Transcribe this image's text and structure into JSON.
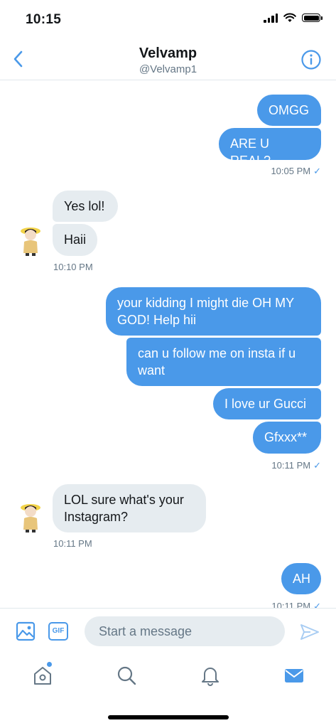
{
  "status_bar": {
    "time": "10:15"
  },
  "header": {
    "name": "Velvamp",
    "handle": "@Velvamp1"
  },
  "messages": [
    {
      "text": "OMGG"
    },
    {
      "text": "ARE U REAL?"
    },
    {
      "time": "10:05 PM",
      "check": "✓"
    },
    {
      "text": "Yes lol!"
    },
    {
      "text": "Haii"
    },
    {
      "time": "10:10 PM"
    },
    {
      "text": "your kidding I might die OH MY GOD! Help hii"
    },
    {
      "text": "can u follow me on insta if u want"
    },
    {
      "text": "I love ur Gucci"
    },
    {
      "text": "Gfxxx**"
    },
    {
      "time": "10:11 PM",
      "check": "✓"
    },
    {
      "text": "LOL sure what's your Instagram?"
    },
    {
      "time": "10:11 PM"
    },
    {
      "text": "AH"
    },
    {
      "time": "10:11 PM",
      "check": "✓"
    }
  ],
  "composer": {
    "placeholder": "Start a message",
    "gif_label": "GIF"
  },
  "tabbar": {
    "home_has_notification": true
  },
  "colors": {
    "accent": "#4a99e9",
    "incoming_bubble": "#e6ecf0",
    "secondary_text": "#657786"
  }
}
